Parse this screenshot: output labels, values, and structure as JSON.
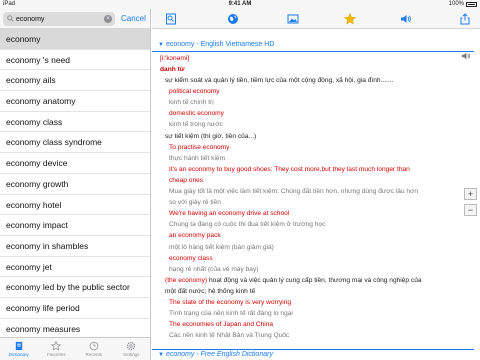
{
  "status": {
    "device": "iPad",
    "time": "9:41 AM",
    "battery": "100%"
  },
  "search": {
    "value": "economy",
    "cancel_label": "Cancel"
  },
  "word_list": [
    "economy",
    "economy 's need",
    "economy ails",
    "economy anatomy",
    "economy class",
    "economy class syndrome",
    "economy device",
    "economy growth",
    "economy hotel",
    "economy impact",
    "economy in shambles",
    "economy jet",
    "economy led by the public sector",
    "economy life period",
    "economy measures"
  ],
  "tabs": [
    {
      "label": "Dictionary",
      "icon": "dictionary-icon"
    },
    {
      "label": "Favorites",
      "icon": "star-icon"
    },
    {
      "label": "Recents",
      "icon": "clock-icon"
    },
    {
      "label": "Settings",
      "icon": "gear-icon"
    }
  ],
  "toolbar_icons": [
    "bookmark-list-icon",
    "globe-icon",
    "image-icon",
    "favorite-star-icon",
    "speaker-icon",
    "share-icon"
  ],
  "entry": {
    "header": "economy - English Vietnamese HD",
    "pronunciation": "[i:'kɔnəmi]",
    "part_of_speech": "danh từ",
    "lines": [
      {
        "style": "blk",
        "text": "sự kiểm soát và quản lý tiền, tiềm lực của một cộng đồng, xã hội, gia đình......."
      },
      {
        "style": "red",
        "text": "political economy"
      },
      {
        "style": "gry",
        "text": "kinh tế chính trị"
      },
      {
        "style": "red",
        "text": "domestic economy"
      },
      {
        "style": "gry",
        "text": "kinh tế trong nước"
      },
      {
        "style": "blk",
        "text": "sự tiết kiệm (thì giờ, tiền của...)"
      },
      {
        "style": "red",
        "text": "To practise economy"
      },
      {
        "style": "gry",
        "text": "thực hành tiết kiệm"
      },
      {
        "style": "red",
        "text": "It's an economy to buy good shoes: They cost more,but they last much longer than"
      },
      {
        "style": "red",
        "text": "cheap ones"
      },
      {
        "style": "gry",
        "text": "Mua giày tốt là một việc làm tiết kiệm: Chúng đắt tiền hơn, nhưng dùng được lâu hơn"
      },
      {
        "style": "gry",
        "text": "so với giày rẻ tiền"
      },
      {
        "style": "red",
        "text": "We're having an economy drive at school"
      },
      {
        "style": "gry",
        "text": "Chúng ta đang có cuộc thi đua tiết kiệm ở trường học"
      },
      {
        "style": "red",
        "text": "an economy pack"
      },
      {
        "style": "gry",
        "text": "một lô hàng tiết kiệm (bán giảm giá)"
      },
      {
        "style": "red",
        "text": "economy class"
      },
      {
        "style": "gry",
        "text": "hạng rẻ nhất (của vé máy bay)"
      },
      {
        "style": "mix",
        "red": "(the economy)",
        "text": " hoạt động và việc quản lý cung cấp tiền, thương mại và công nghiệp của"
      },
      {
        "style": "blk",
        "text": "một đất nước; hệ thống kinh tế"
      },
      {
        "style": "red",
        "text": "The state of the economy is very worrying"
      },
      {
        "style": "gry",
        "text": "Tình trạng của nền kinh tế rất đáng lo ngại"
      },
      {
        "style": "red",
        "text": "The economies of Japan and China"
      },
      {
        "style": "gry",
        "text": "Các nền kinh tế Nhật Bản và Trung Quốc"
      }
    ],
    "footer": "economy - Free English Dictionary",
    "zoom_in": "+",
    "zoom_out": "−"
  }
}
